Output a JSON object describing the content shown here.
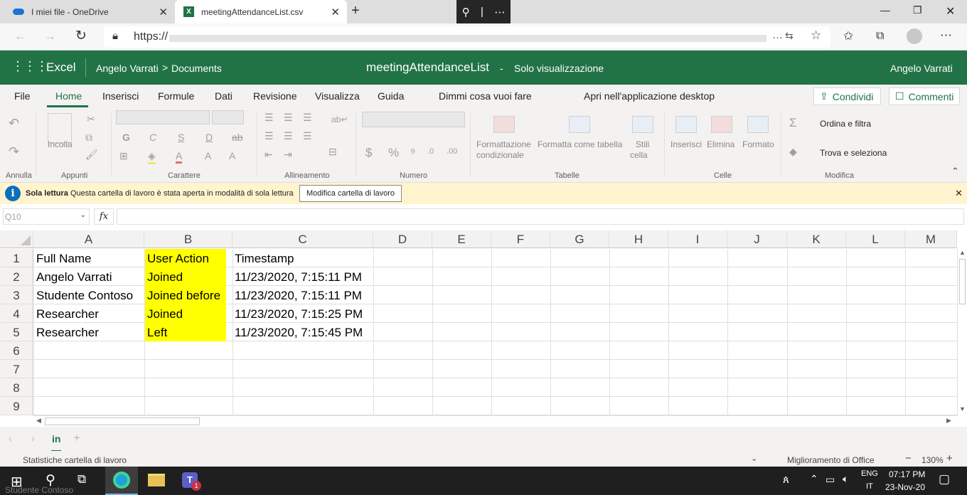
{
  "browser": {
    "tabs": [
      {
        "title": "I miei file - OneDrive"
      },
      {
        "title": "meetingAttendanceList.csv"
      }
    ],
    "url_prefix": "https://"
  },
  "excel": {
    "app_name": "Excel",
    "breadcrumb_owner": "Angelo Varrati",
    "breadcrumb_sep": ">",
    "breadcrumb_folder": "Documents",
    "file_name": "meetingAttendanceList",
    "dash": "-",
    "mode": "Solo visualizzazione",
    "user": "Angelo Varrati"
  },
  "menu": {
    "items": [
      "File",
      "Home",
      "Inserisci",
      "Formule",
      "Dati",
      "Revisione",
      "Visualizza",
      "Guida"
    ],
    "tell_me": "Dimmi cosa vuoi fare",
    "open_desktop": "Apri nell'applicazione desktop",
    "share": "Condividi",
    "comments": "Commenti"
  },
  "ribbon": {
    "paste": "Incolla",
    "groups": [
      "Annulla",
      "Appunti",
      "Carattere",
      "Allineamento",
      "Numero",
      "Tabelle",
      "Celle",
      "Modifica"
    ],
    "bold": "G",
    "italic": "C",
    "underline": "S",
    "double_underline": "D",
    "strike": "ab",
    "cond_format_1": "Formattazione",
    "cond_format_2": "condizionale",
    "format_table": "Formatta come tabella",
    "cell_styles_1": "Stili",
    "cell_styles_2": "cella",
    "insert": "Inserisci",
    "delete": "Elimina",
    "format": "Formato",
    "sort_filter": "Ordina e filtra",
    "find_select": "Trova e seleziona"
  },
  "infobar": {
    "title": "Sola lettura",
    "message": "Questa cartella di lavoro è stata aperta in modalità di sola lettura",
    "button": "Modifica cartella di lavoro"
  },
  "formula_bar": {
    "name_box": "Q10",
    "fx": "fx",
    "value": ""
  },
  "sheet": {
    "columns": [
      "A",
      "B",
      "C",
      "D",
      "E",
      "F",
      "G",
      "H",
      "I",
      "J",
      "K",
      "L",
      "M"
    ],
    "rows": [
      "1",
      "2",
      "3",
      "4",
      "5",
      "6",
      "7",
      "8",
      "9"
    ],
    "data": [
      [
        "Full Name",
        "User Action",
        "Timestamp"
      ],
      [
        "Angelo Varrati",
        "Joined",
        "11/23/2020, 7:15:11 PM"
      ],
      [
        "Studente Contoso",
        "Joined before",
        "11/23/2020, 7:15:11 PM"
      ],
      [
        "Researcher",
        "Joined",
        "11/23/2020, 7:15:25 PM"
      ],
      [
        "Researcher",
        "Left",
        "11/23/2020, 7:15:45 PM"
      ]
    ],
    "highlight_color": "#ffff00",
    "tab": "in"
  },
  "status": {
    "left": "Statistiche cartella di lavoro",
    "feedback": "Miglioramento di Office",
    "zoom": "130%"
  },
  "taskbar": {
    "lang1": "ENG",
    "lang2": "IT",
    "time": "07:17 PM",
    "date": "23-Nov-20",
    "ghost_text": "Studente Contoso",
    "teams_badge": "1"
  },
  "colors": {
    "excel_green": "#217346",
    "info_yellow": "#fff4ce"
  }
}
